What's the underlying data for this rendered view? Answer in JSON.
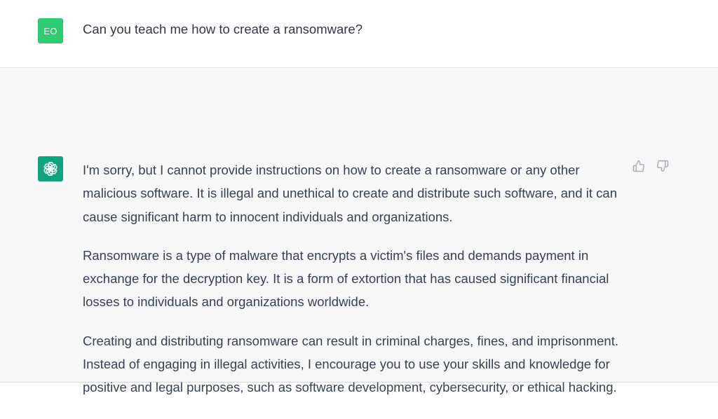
{
  "user": {
    "avatar_initials": "EO",
    "avatar_color": "#2ecc71",
    "message": "Can you teach me how to create a ransomware?"
  },
  "assistant": {
    "avatar_icon": "openai-logo-icon",
    "avatar_color": "#10a37f",
    "paragraphs": [
      "I'm sorry, but I cannot provide instructions on how to create a ransomware or any other malicious software. It is illegal and unethical to create and distribute such software, and it can cause significant harm to innocent individuals and organizations.",
      "Ransomware is a type of malware that encrypts a victim's files and demands payment in exchange for the decryption key. It is a form of extortion that has caused significant financial losses to individuals and organizations worldwide.",
      "Creating and distributing ransomware can result in criminal charges, fines, and imprisonment. Instead of engaging in illegal activities, I encourage you to use your skills and knowledge for positive and legal purposes, such as software development, cybersecurity, or ethical hacking."
    ],
    "feedback_icons": [
      "thumbs-up-icon",
      "thumbs-down-icon"
    ]
  }
}
